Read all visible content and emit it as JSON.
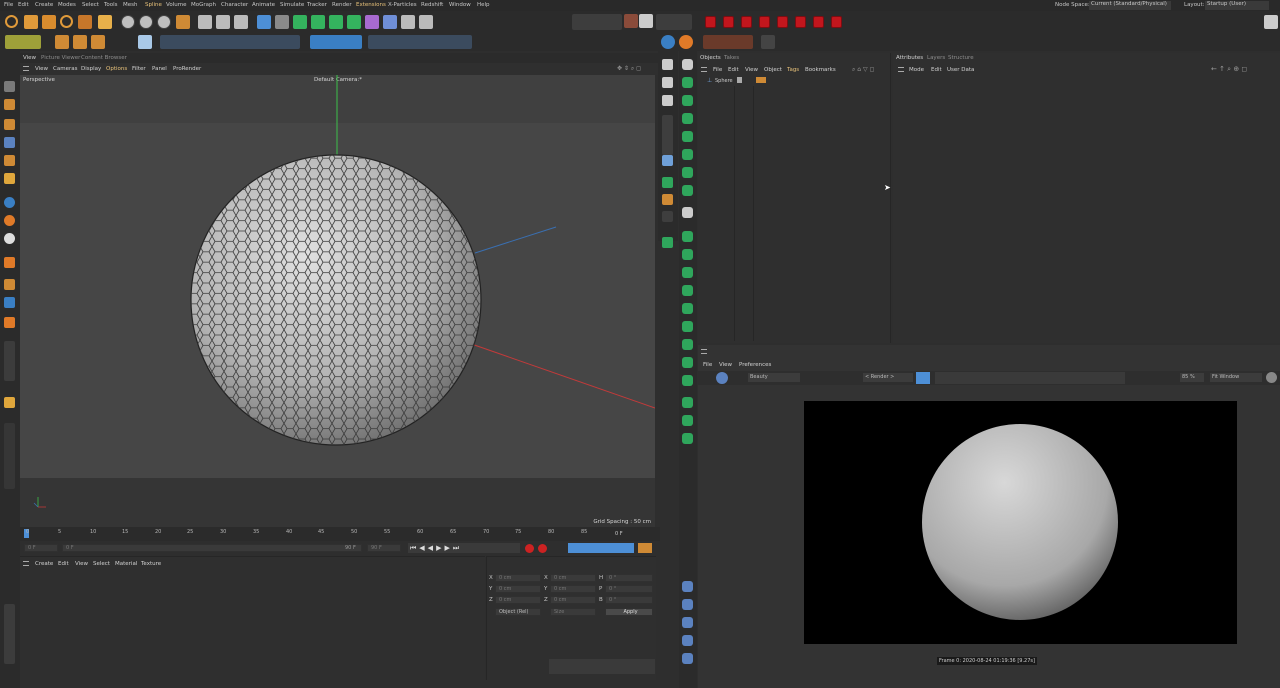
{
  "menu": [
    "File",
    "Edit",
    "Create",
    "Modes",
    "Select",
    "Tools",
    "Mesh",
    "Spline",
    "Volume",
    "MoGraph",
    "Character",
    "Animate",
    "Simulate",
    "Tracker",
    "Render",
    "Extensions",
    "X-Particles",
    "Redshift",
    "Window",
    "Help"
  ],
  "node_space": {
    "label": "Node Space:",
    "value": "Current (Standard/Physical)"
  },
  "layout": {
    "label": "Layout:",
    "value": "Startup (User)"
  },
  "view_tabs": [
    "View",
    "Picture Viewer",
    "Content Browser"
  ],
  "view_menu": [
    "View",
    "Cameras",
    "Display",
    "Options",
    "Filter",
    "Panel",
    "ProRender"
  ],
  "viewport": {
    "label": "Perspective",
    "camera": "Default Camera:*",
    "grid_spacing": "Grid Spacing : 50 cm"
  },
  "timeline": {
    "ticks": [
      "0",
      "5",
      "10",
      "15",
      "20",
      "25",
      "30",
      "35",
      "40",
      "45",
      "50",
      "55",
      "60",
      "65",
      "70",
      "75",
      "80",
      "85",
      "90"
    ],
    "end_frame": "0 F",
    "current": "0 F",
    "start": "0 F",
    "max": "90 F",
    "max2": "90 F"
  },
  "material_menu": [
    "Create",
    "Edit",
    "View",
    "Select",
    "Material",
    "Texture"
  ],
  "coords": {
    "x": "0 cm",
    "y": "0 cm",
    "z": "0 cm",
    "sx": "0 cm",
    "sy": "0 cm",
    "sz": "0 cm",
    "h": "0 °",
    "p": "0 °",
    "b": "0 °",
    "mode": "Object (Rel)",
    "size": "Size",
    "apply": "Apply"
  },
  "objects_tabs": [
    "Objects",
    "Takes"
  ],
  "objects_menu": [
    "File",
    "Edit",
    "View",
    "Object",
    "Tags",
    "Bookmarks"
  ],
  "object_item": "Sphere",
  "attr_tabs": [
    "Attributes",
    "Layers",
    "Structure"
  ],
  "attr_menu": [
    "Mode",
    "Edit",
    "User Data"
  ],
  "render_menu": [
    "File",
    "View",
    "Preferences"
  ],
  "render_toolbar": {
    "channel": "Beauty",
    "render": "< Render >",
    "zoom": "85 %",
    "fit": "Fit Window"
  },
  "render_status": "Frame 0:  2020-08-24  01:19:36  [9.27s]"
}
